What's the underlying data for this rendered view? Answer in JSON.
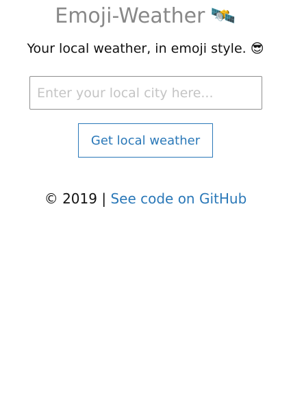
{
  "header": {
    "title": "Emoji-Weather",
    "title_emoji": "🛰️",
    "tagline": "Your local weather, in emoji style. 😎"
  },
  "search": {
    "placeholder": "Enter your local city here...",
    "value": ""
  },
  "actions": {
    "get_weather_label": "Get local weather"
  },
  "footer": {
    "copyright": "© 2019 | ",
    "github_link_label": "See code on GitHub"
  },
  "colors": {
    "title": "#888888",
    "accent": "#2a78b8",
    "text": "#111111",
    "placeholder": "#c4c4c4"
  }
}
